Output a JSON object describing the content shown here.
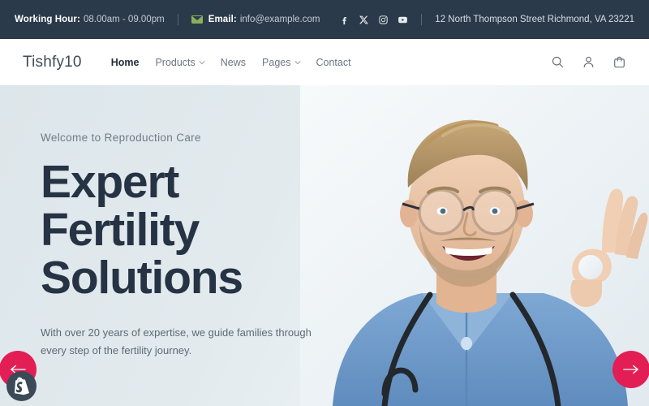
{
  "topbar": {
    "working_hour_label": "Working Hour:",
    "working_hour_value": "08.00am - 09.00pm",
    "email_label": "Email:",
    "email_value": "info@example.com",
    "email_icon": "envelope-icon",
    "address": "12 North Thompson Street Richmond, VA 23221",
    "socials": [
      {
        "name": "facebook-icon",
        "label": "Facebook"
      },
      {
        "name": "x-twitter-icon",
        "label": "X"
      },
      {
        "name": "instagram-icon",
        "label": "Instagram"
      },
      {
        "name": "youtube-icon",
        "label": "YouTube"
      }
    ],
    "bg_color": "#2b3a4a",
    "text_color": "#d9dee3"
  },
  "header": {
    "logo": "Tishfy10",
    "nav": [
      {
        "label": "Home",
        "has_dropdown": false,
        "active": true
      },
      {
        "label": "Products",
        "has_dropdown": true,
        "active": false
      },
      {
        "label": "News",
        "has_dropdown": false,
        "active": false
      },
      {
        "label": "Pages",
        "has_dropdown": true,
        "active": false
      },
      {
        "label": "Contact",
        "has_dropdown": false,
        "active": false
      }
    ],
    "actions": [
      {
        "name": "search-icon",
        "label": "Search"
      },
      {
        "name": "account-icon",
        "label": "Account"
      },
      {
        "name": "cart-icon",
        "label": "Cart"
      }
    ]
  },
  "hero": {
    "eyebrow": "Welcome to Reproduction Care",
    "headline_line1": "Expert",
    "headline_line2": "Fertility",
    "headline_line3": "Solutions",
    "subcopy": "With over 20 years of expertise, we guide families through every step of the fertility journey.",
    "image_alt": "Smiling doctor in blue scrubs with stethoscope and round glasses making an OK hand gesture",
    "prev_label": "Previous slide",
    "next_label": "Next slide",
    "accent_color": "#e31e55",
    "heading_color": "#253344",
    "bg_color": "#dde6ea"
  },
  "badge": {
    "name": "shopify-badge",
    "label": "Shopify"
  }
}
